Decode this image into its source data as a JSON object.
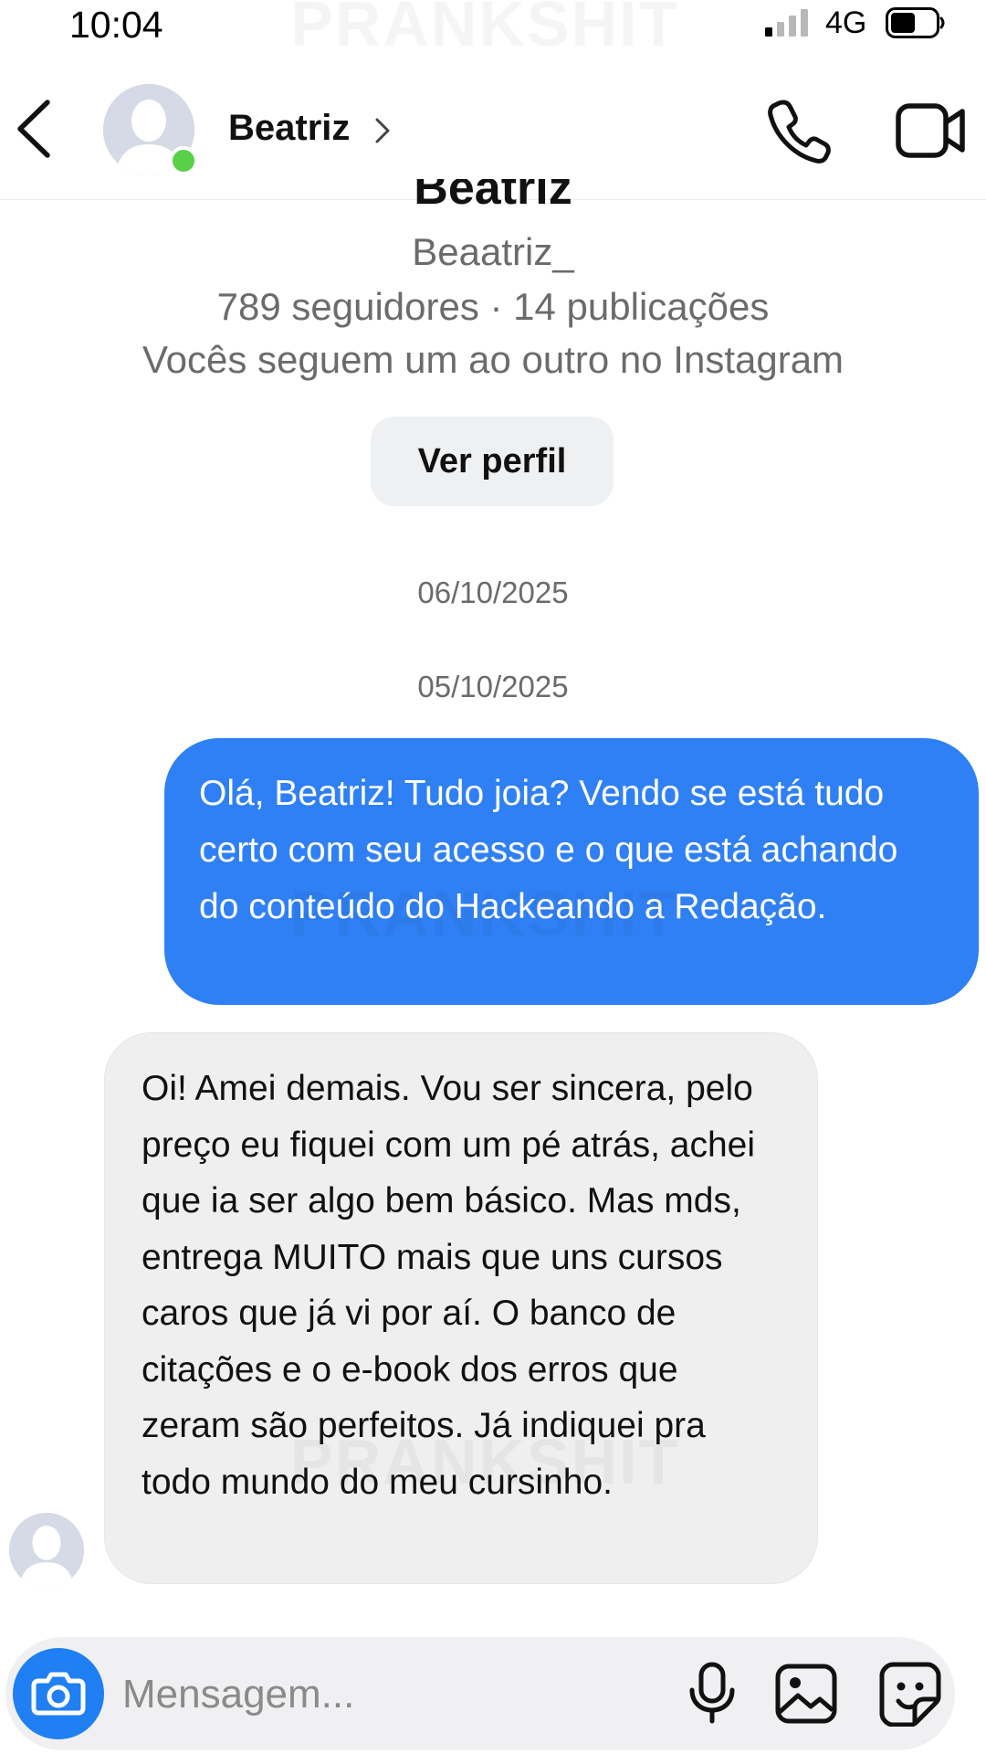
{
  "status_bar": {
    "time": "10:04",
    "network": "4G"
  },
  "watermark": "PRANKSHIT",
  "header": {
    "contact_name": "Beatriz",
    "icons": {
      "back": "back-chevron-icon",
      "call": "phone-icon",
      "video": "video-camera-icon"
    }
  },
  "profile": {
    "name": "Beatriz",
    "handle": "Beaatriz_",
    "stats": "789 seguidores · 14 publicações",
    "mutual": "Vocês seguem um ao outro no Instagram",
    "view_profile_label": "Ver perfil"
  },
  "dates": [
    "06/10/2025",
    "05/10/2025"
  ],
  "messages": [
    {
      "sender": "me",
      "text": "Olá, Beatriz! Tudo joia? Vendo se está tudo certo com seu acesso e o que está achando do conteúdo do Hackeando a Redação."
    },
    {
      "sender": "Beatriz",
      "text": "Oi! Amei demais. Vou ser sincera, pelo preço eu fiquei com um pé atrás, achei que ia ser algo bem básico. Mas mds, entrega MUITO mais que uns cursos caros que já vi por aí. O banco de citações e o e-book dos erros que zeram são perfeitos. Já indiquei pra todo mundo do meu cursinho."
    }
  ],
  "composer": {
    "placeholder": "Mensagem...",
    "icons": {
      "camera": "camera-icon",
      "mic": "microphone-icon",
      "gallery": "gallery-icon",
      "sticker": "sticker-icon"
    }
  },
  "colors": {
    "outgoing_bubble": "#2f80f5",
    "incoming_bubble": "#efefef",
    "online_dot": "#58d048",
    "camera_button": "#1f7ff3"
  }
}
